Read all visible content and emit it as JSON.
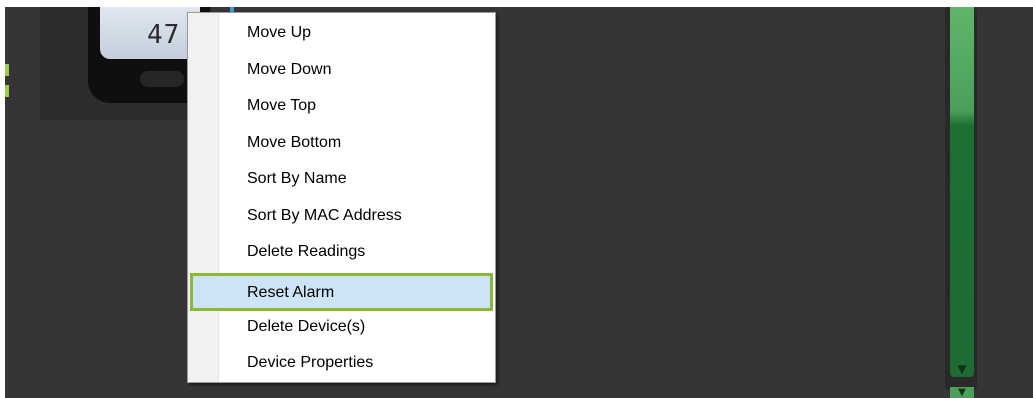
{
  "device": {
    "reading": "47"
  },
  "context_menu": {
    "items": [
      {
        "label": "Move Up",
        "highlighted": false
      },
      {
        "label": "Move Down",
        "highlighted": false
      },
      {
        "label": "Move Top",
        "highlighted": false
      },
      {
        "label": "Move Bottom",
        "highlighted": false
      },
      {
        "label": "Sort By Name",
        "highlighted": false
      },
      {
        "label": "Sort By MAC Address",
        "highlighted": false
      },
      {
        "label": "Delete Readings",
        "highlighted": false
      },
      {
        "label": "Reset Alarm",
        "highlighted": true
      },
      {
        "label": "Delete Device(s)",
        "highlighted": false
      },
      {
        "label": "Device Properties",
        "highlighted": false
      }
    ]
  },
  "colors": {
    "background": "#363434",
    "scrollbar_green": "#1f6b33",
    "highlight_fill": "#cde3f6",
    "highlight_border": "#8ab83a",
    "selection_line": "#3c9ad8"
  },
  "icons": [
    "scroll-down-arrow-icon"
  ]
}
